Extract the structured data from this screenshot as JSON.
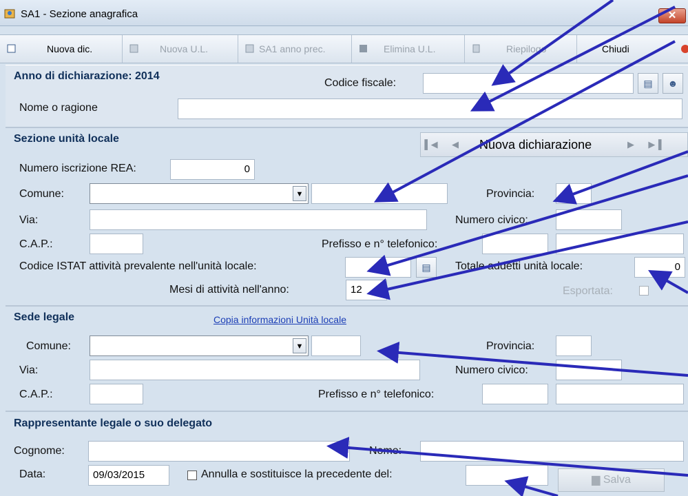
{
  "window": {
    "title": "SA1 - Sezione anagrafica",
    "close_glyph": "✕"
  },
  "toolbar": {
    "new_decl": "Nuova dic.",
    "new_ul": "Nuova U.L.",
    "sa1_prev": "SA1 anno prec.",
    "delete_ul": "Elimina U.L.",
    "summary": "Riepilogo",
    "close": "Chiudi"
  },
  "header": {
    "year_label": "Anno di dichiarazione: 2014",
    "tax_code_label": "Codice fiscale:",
    "tax_code_value": "",
    "name_label": "Nome o ragione",
    "name_value": ""
  },
  "local_unit": {
    "title": "Sezione unità locale",
    "nav_label": "Nuova dichiarazione",
    "rea_label": "Numero iscrizione REA:",
    "rea_value": "0",
    "comune_label": "Comune:",
    "comune_value": "",
    "provincia_label": "Provincia:",
    "provincia_value": "",
    "via_label": "Via:",
    "via_value": "",
    "civico_label": "Numero civico:",
    "civico_value": "",
    "cap_label": "C.A.P.:",
    "cap_value": "",
    "phone_label": "Prefisso e n° telefonico:",
    "istat_label": "Codice ISTAT attività prevalente nell'unità locale:",
    "istat_value": "",
    "employees_label": "Totale addetti unità locale:",
    "employees_value": "0",
    "months_label": "Mesi di attività nell'anno:",
    "months_value": "12",
    "exported_label": "Esportata:"
  },
  "legal_seat": {
    "title": "Sede legale",
    "copy_link": "Copia informazioni Unità locale",
    "comune_label": "Comune:",
    "provincia_label": "Provincia:",
    "via_label": "Via:",
    "civico_label": "Numero civico:",
    "cap_label": "C.A.P.:",
    "phone_label": "Prefisso e n° telefonico:"
  },
  "representative": {
    "title": "Rappresentante legale o suo delegato",
    "surname_label": "Cognome:",
    "name_label": "Nome:",
    "date_label": "Data:",
    "date_value": "09/03/2015",
    "replace_label": "Annulla e sostituisce la precedente del:",
    "replace_value": "",
    "save_label": "Salva"
  },
  "colors": {
    "arrow": "#2a2ab8",
    "section_title": "#10305a",
    "link": "#1a3db5"
  }
}
